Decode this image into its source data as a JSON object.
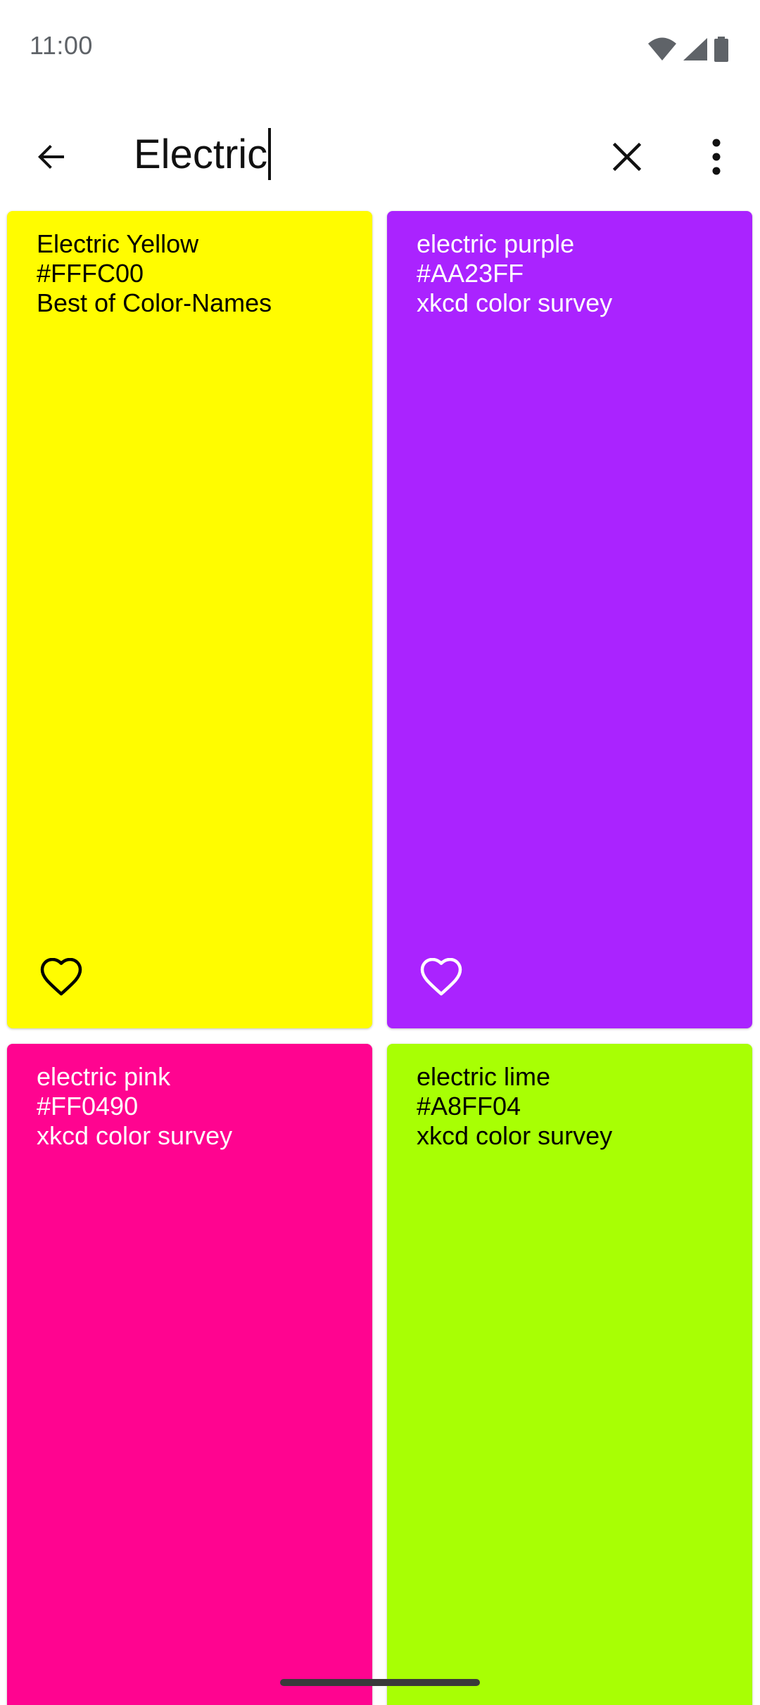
{
  "status_bar": {
    "time": "11:00",
    "icons": [
      "wifi-icon",
      "cell-signal-icon",
      "battery-icon"
    ]
  },
  "app_bar": {
    "back_icon": "arrow-left-icon",
    "search_value": "Electric",
    "clear_icon": "close-icon",
    "menu_icon": "more-vert-icon"
  },
  "colors": [
    {
      "name": "Electric Yellow",
      "hex": "#FFFC00",
      "source": "Best of Color-Names",
      "background": "#FFFC00",
      "text_color": "#000000",
      "favorite_icon": "heart-outline-icon"
    },
    {
      "name": "electric purple",
      "hex": "#AA23FF",
      "source": "xkcd color survey",
      "background": "#AA23FF",
      "text_color": "#FFFFFF",
      "favorite_icon": "heart-outline-icon"
    },
    {
      "name": "electric pink",
      "hex": "#FF0490",
      "source": "xkcd color survey",
      "background": "#FF0490",
      "text_color": "#FFFFFF"
    },
    {
      "name": "electric lime",
      "hex": "#A8FF04",
      "source": "xkcd color survey",
      "background": "#A8FF04",
      "text_color": "#000000"
    }
  ]
}
